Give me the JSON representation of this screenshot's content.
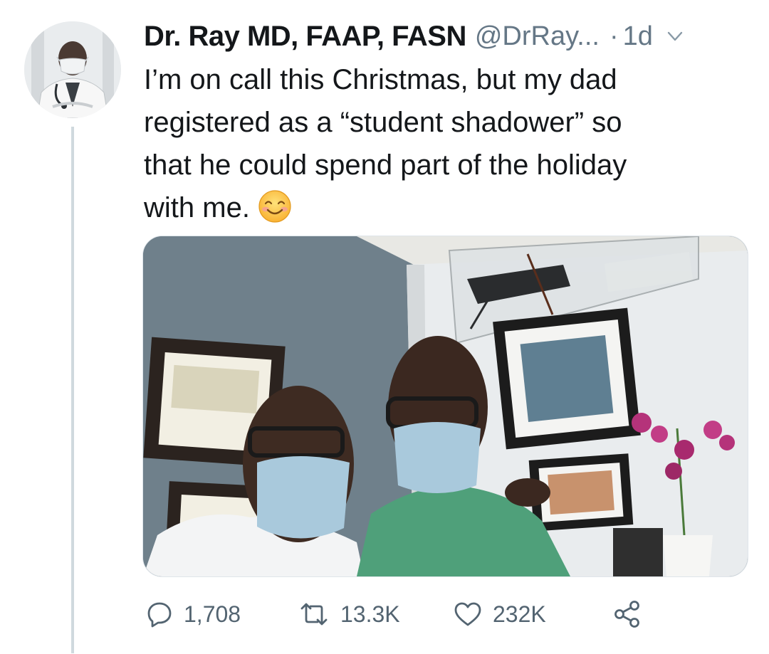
{
  "tweet": {
    "display_name": "Dr. Ray MD, FAAP, FASN",
    "handle": "@DrRay...",
    "separator": "·",
    "time": "1d",
    "text_lines": [
      "I’m on call this Christmas, but my dad",
      "registered as a “student shadower” so",
      "that he could spend part of the holiday",
      "with me."
    ],
    "emoji": "smiling-face-with-smiling-eyes",
    "actions": {
      "reply_count": "1,708",
      "retweet_count": "13.3K",
      "like_count": "232K"
    }
  },
  "icons": {
    "caret": "chevron-down-icon",
    "reply": "speech-bubble-icon",
    "retweet": "retweet-icon",
    "like": "heart-icon",
    "share": "share-icon"
  },
  "colors": {
    "text": "#14171a",
    "secondary": "#657786",
    "action": "#536471",
    "thread_line": "#cfd9de"
  }
}
